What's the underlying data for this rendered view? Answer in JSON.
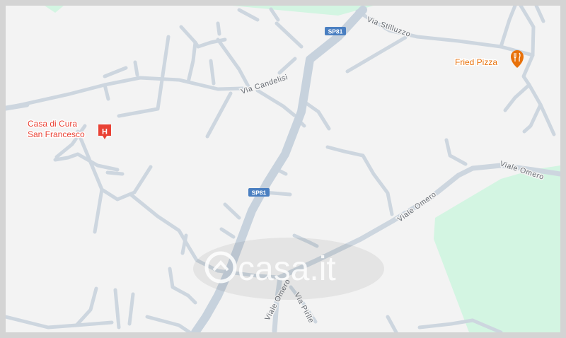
{
  "map": {
    "streets": {
      "via_stilluzzo": "Via Stilluzzo",
      "via_candelisi": "Via Candelisi",
      "viale_omero_east": "Viale Omero",
      "viale_omero_center": "Viale Omero",
      "viale_omero_south": "Viale Omero",
      "via_pirlle": "Via Pirlle"
    },
    "road_shields": {
      "north": "SP81",
      "center": "SP81"
    },
    "pois": [
      {
        "name_line1": "Casa di Cura",
        "name_line2": "San Francesco",
        "icon": "hospital-icon",
        "color": "#e94235"
      },
      {
        "name": "Fried Pizza",
        "icon": "restaurant-icon",
        "color": "#e8710a"
      }
    ],
    "watermark": "casa.it",
    "colors": {
      "background": "#f3f3f3",
      "road": "#cdd6df",
      "park": "#d3f5e2",
      "shield": "#4a7fc1"
    }
  }
}
